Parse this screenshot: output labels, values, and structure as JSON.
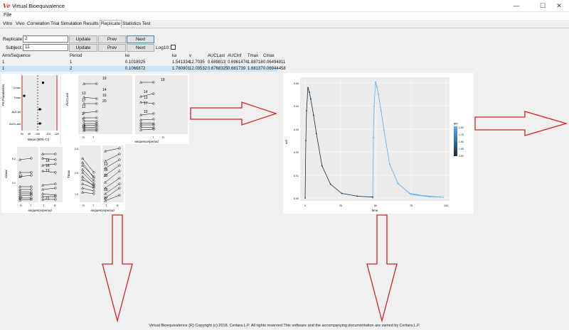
{
  "window": {
    "title": "Virtual Bioequivalence",
    "icon_text": "Ve",
    "minimize": "—",
    "maximize": "☐",
    "close": "✕"
  },
  "menu": {
    "file": "File"
  },
  "tabs": [
    "Vitro",
    "Vivo",
    "Correlation",
    "Trial Simulation",
    "Results",
    "Replicate",
    "Statistics Test"
  ],
  "active_tab": "Replicate",
  "controls": {
    "replicate_label": "Replicate:",
    "replicate_value": "2",
    "subject_label": "Subject:",
    "subject_value": "11",
    "update_label": "Update",
    "prev_label": "Prev",
    "next_label": "Next",
    "log10_label": "Log10:"
  },
  "table": {
    "headers": [
      "Arm/Sequence",
      "Period",
      "ke",
      "ka",
      "v",
      "AUCLast",
      "AUCInf",
      "Tmax",
      "Cmax"
    ],
    "rows": [
      [
        "1",
        "1",
        "0.1018925",
        "1.541334",
        "12.7035",
        "0.689813",
        "0.6961474",
        "1.88718",
        "0.06494811"
      ],
      [
        "1",
        "2",
        "0.1066872",
        "1.780901",
        "12.03532",
        "0.6768325",
        "0.681739",
        "1.68137",
        "0.06944458"
      ]
    ]
  },
  "forest_plot": {
    "ylabel": "PK Parameters",
    "xlabel": "Mean (90% CI)",
    "params": [
      "Cmax",
      "Tmax",
      "AUCinf",
      "AUCLast"
    ],
    "xticks": [
      "90",
      "95",
      "100",
      "110",
      "120"
    ]
  },
  "spaghetti": {
    "xlabel": "sequence/period",
    "xticks": [
      "R",
      "T",
      "T",
      "R"
    ],
    "auclast_ylabel": "AUCLast",
    "cmax_ylabel": "Cmax",
    "tmax_ylabel": "Tmax",
    "tmax_yticks": [
      "1.5",
      "2.0",
      "2.5"
    ],
    "cmax_yticks": [
      "0.1",
      "0.2"
    ],
    "subject_labels_a": [
      "19",
      "14",
      "16",
      "20",
      "13",
      "10",
      "17",
      "12",
      "3",
      "7",
      "15"
    ],
    "subject_labels_b": [
      "18",
      "16",
      "13",
      "12",
      "17",
      "21"
    ],
    "subject_labels_c": [
      "13",
      "16",
      "20",
      "19",
      "17"
    ]
  },
  "conc_plot": {
    "ylabel": "val",
    "xlabel": "time",
    "yticks": [
      "0.00",
      "0.01",
      "0.02",
      "0.03",
      "0.04",
      "0.05"
    ],
    "xticks": [
      "0",
      "25",
      "50",
      "75",
      "100"
    ],
    "legend_title": "grp",
    "legend_ticks": [
      "2.00",
      "1.75",
      "1.50",
      "1.25",
      "1.00"
    ],
    "low_color": "#132b43",
    "high_color": "#56b1f7"
  },
  "footer": "Virtual Bioequivalence (R) Copyright (c) 2018. Certara L.P. All rights reserved.This software and the accompanying documentation are owned by Certara L.P."
}
